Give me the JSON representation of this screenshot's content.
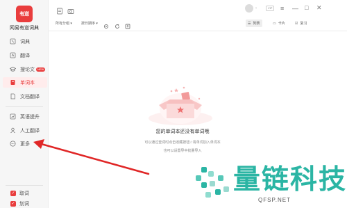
{
  "app": {
    "logo_text": "有道",
    "name": "网易有道词典"
  },
  "sidebar": {
    "items": [
      {
        "label": "词典",
        "icon": "book-icon"
      },
      {
        "label": "翻译",
        "icon": "translate-icon"
      },
      {
        "label": "搜论文",
        "icon": "graduation-cap-icon",
        "badge": "NEW"
      },
      {
        "label": "单词本",
        "icon": "wordbook-icon",
        "active": true
      },
      {
        "label": "文档翻译",
        "icon": "document-icon"
      },
      {
        "label": "英语提升",
        "icon": "chart-icon"
      },
      {
        "label": "人工翻译",
        "icon": "person-icon"
      },
      {
        "label": "更多",
        "icon": "more-icon"
      }
    ],
    "bottom": [
      {
        "label": "取词"
      },
      {
        "label": "划词"
      }
    ]
  },
  "toolbar": {
    "filter_group": "所有分组",
    "filter_sort": "按日期序",
    "view_list": "列表",
    "view_card": "卡片",
    "view_review": "复习"
  },
  "header": {
    "vip": "VIP"
  },
  "empty_state": {
    "title": "您的单词本还没有单词哦",
    "line1": "可以通过查词时点击收藏按钮☆将单词加入单词本",
    "line2": "也可以设置导中批量导入"
  },
  "watermark": {
    "text": "量链科技",
    "url": "QFSP.NET"
  },
  "colors": {
    "accent": "#e93d3d",
    "watermark": "#2bb5a4",
    "arrow": "#e02626"
  }
}
